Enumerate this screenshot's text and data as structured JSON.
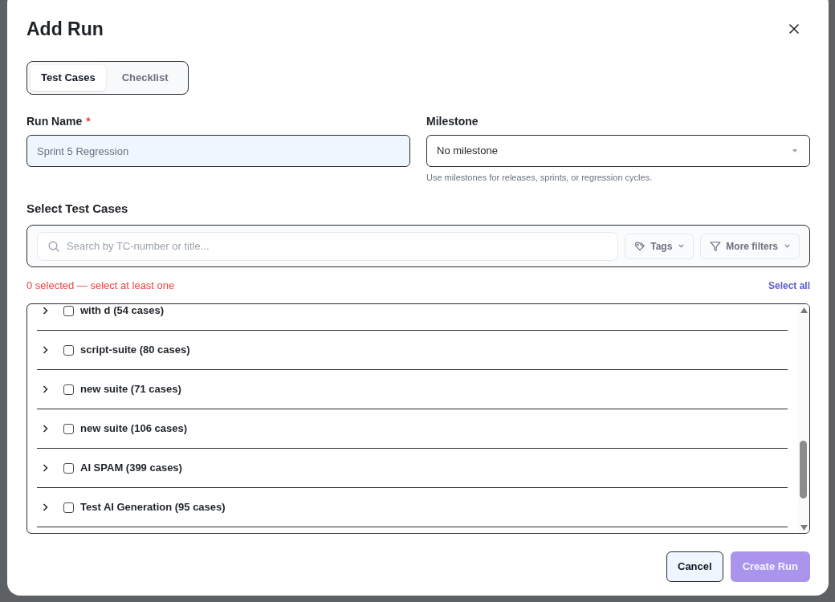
{
  "dialog": {
    "title": "Add Run"
  },
  "tabs": [
    {
      "label": "Test Cases",
      "selected": true
    },
    {
      "label": "Checklist",
      "selected": false
    }
  ],
  "run_name": {
    "label": "Run Name",
    "required_mark": "*",
    "placeholder": "Sprint 5 Regression",
    "focused": true
  },
  "milestone": {
    "label": "Milestone",
    "value": "No milestone",
    "hint": "Use milestones for releases, sprints, or regression cycles."
  },
  "test_cases": {
    "heading": "Select Test Cases",
    "search": {
      "placeholder": "Search by TC-number or title..."
    },
    "filters": [
      {
        "kind": "tags",
        "label": "Tags"
      },
      {
        "kind": "more",
        "label": "More filters"
      }
    ],
    "selection_status": "0 selected — select at least one",
    "select_all": "Select all",
    "suites": [
      {
        "label": "with d (54 cases)",
        "checked": false,
        "expanded": false
      },
      {
        "label": "script-suite (80 cases)",
        "checked": false,
        "expanded": false
      },
      {
        "label": "new suite (71 cases)",
        "checked": false,
        "expanded": false
      },
      {
        "label": "new suite (106 cases)",
        "checked": false,
        "expanded": false
      },
      {
        "label": "AI SPAM (399 cases)",
        "checked": false,
        "expanded": false
      },
      {
        "label": "Test AI Generation (95 cases)",
        "checked": false,
        "expanded": false
      }
    ]
  },
  "buttons": [
    {
      "kind": "secondary",
      "label": "Cancel"
    },
    {
      "kind": "primary",
      "label": "Create Run",
      "disabled": true
    }
  ]
}
